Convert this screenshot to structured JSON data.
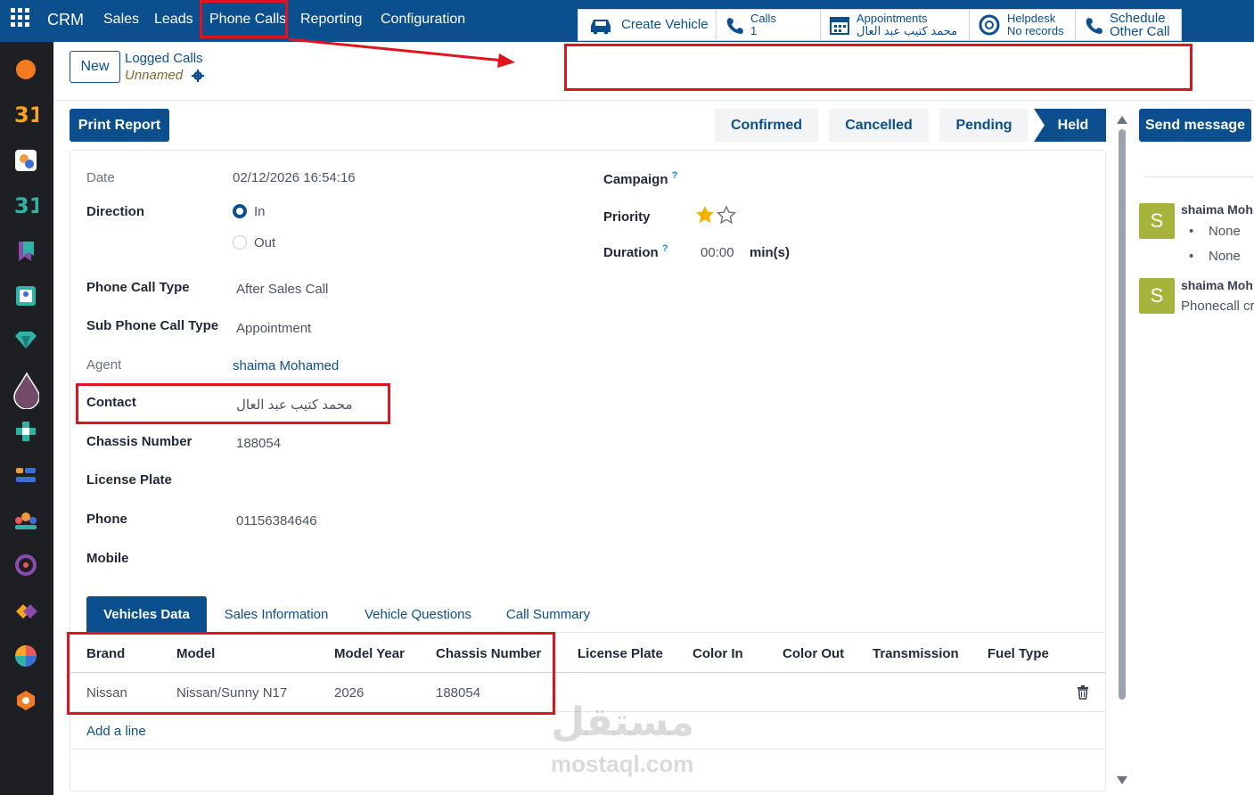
{
  "topbar": {
    "app": "CRM",
    "menu": [
      "Sales",
      "Leads",
      "Phone Calls",
      "Reporting",
      "Configuration"
    ]
  },
  "control": {
    "new_label": "New",
    "breadcrumb": "Logged Calls",
    "record_name": "Unnamed",
    "smart_buttons": {
      "vehicle": "Create Vehicle",
      "calls_label": "Calls",
      "calls_count": "1",
      "appt_label": "Appointments",
      "appt_value": "محمد كتيب عبد العال",
      "helpdesk_label": "Helpdesk",
      "helpdesk_value": "No records",
      "schedule_line1": "Schedule",
      "schedule_line2": "Other Call"
    }
  },
  "actions": {
    "print": "Print Report",
    "send": "Send message",
    "stages": [
      "Confirmed",
      "Cancelled",
      "Pending",
      "Held"
    ],
    "active_stage": "Held"
  },
  "form": {
    "date_label": "Date",
    "date_value": "02/12/2026 16:54:16",
    "direction_label": "Direction",
    "direction_in": "In",
    "direction_out": "Out",
    "call_type_label": "Phone Call Type",
    "call_type_value": "After Sales Call",
    "sub_type_label": "Sub Phone Call Type",
    "sub_type_value": "Appointment",
    "agent_label": "Agent",
    "agent_value": "shaima Mohamed",
    "contact_label": "Contact",
    "contact_value": "محمد كتيب عبد العال",
    "chassis_label": "Chassis Number",
    "chassis_value": "188054",
    "plate_label": "License Plate",
    "phone_label": "Phone",
    "phone_value": "01156384646",
    "mobile_label": "Mobile",
    "campaign_label": "Campaign",
    "priority_label": "Priority",
    "priority_stars": 1,
    "duration_label": "Duration",
    "duration_value": "00:00",
    "duration_unit": "min(s)",
    "help_mark": "?"
  },
  "tabs": [
    "Vehicles Data",
    "Sales Information",
    "Vehicle Questions",
    "Call Summary"
  ],
  "vehicles": {
    "columns": [
      "Brand",
      "Model",
      "Model Year",
      "Chassis Number",
      "License Plate",
      "Color In",
      "Color Out",
      "Transmission",
      "Fuel Type"
    ],
    "row": [
      "Nissan",
      "Nissan/Sunny N17",
      "2026",
      "188054"
    ],
    "add_line": "Add a line"
  },
  "chatter": {
    "avatar_letter": "S",
    "msg1_name": "shaima Moh",
    "msg1_items": [
      "None",
      "None"
    ],
    "msg2_name": "shaima Moh",
    "msg2_text": "Phonecall cr"
  },
  "watermark": {
    "arabic": "مستقل",
    "latin": "mostaql.com"
  },
  "colors": {
    "primary": "#0b4f8f",
    "annotation": "#e0141e",
    "avatar": "#a7b43b",
    "star": "#f3b200"
  }
}
